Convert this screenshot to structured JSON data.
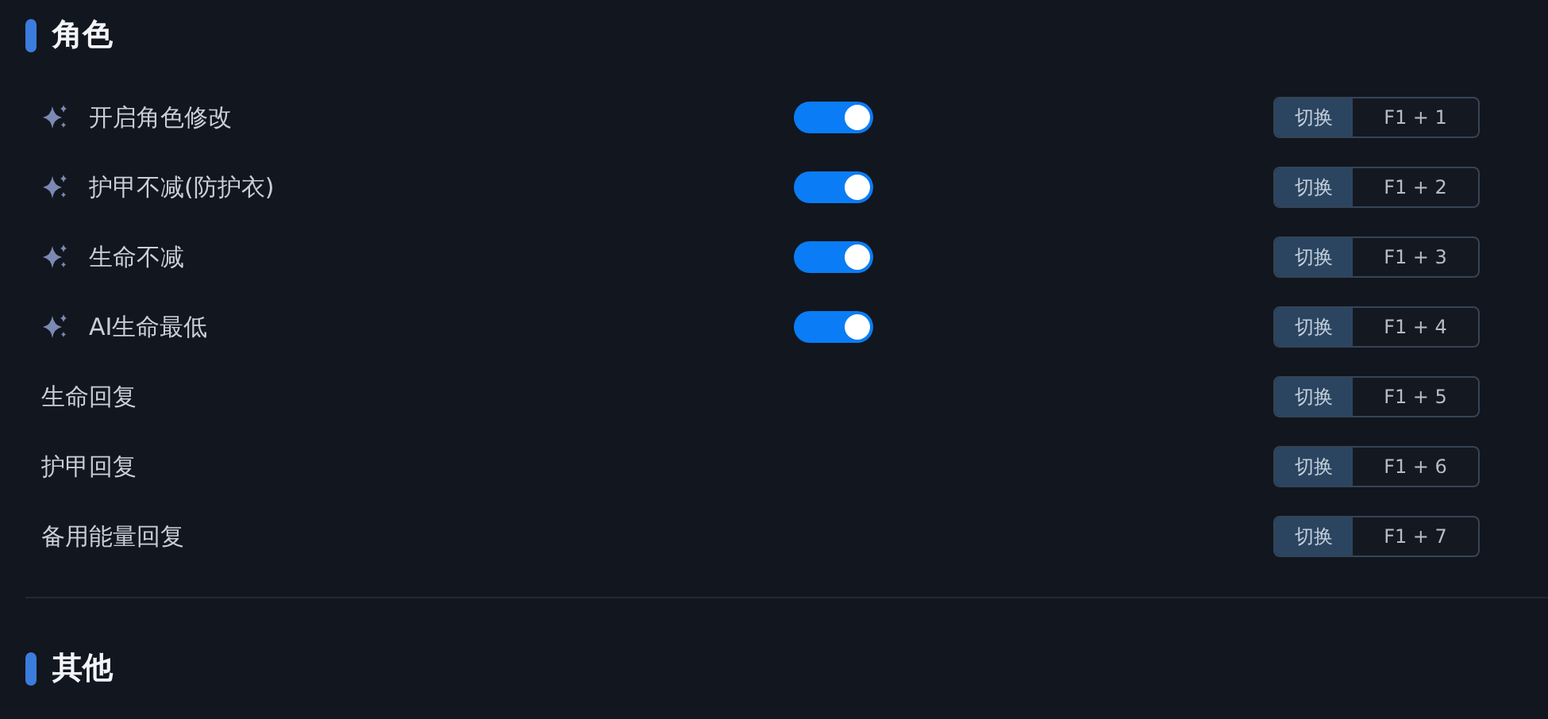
{
  "sections": [
    {
      "title": "角色",
      "rows": [
        {
          "kind": "toggle",
          "label": "开启角色修改",
          "on": true,
          "action": "切换",
          "hotkey": "F1 + 1"
        },
        {
          "kind": "toggle",
          "label": "护甲不减(防护衣)",
          "on": true,
          "action": "切换",
          "hotkey": "F1 + 2"
        },
        {
          "kind": "toggle",
          "label": "生命不减",
          "on": true,
          "action": "切换",
          "hotkey": "F1 + 3"
        },
        {
          "kind": "toggle",
          "label": "AI生命最低",
          "on": true,
          "action": "切换",
          "hotkey": "F1 + 4"
        },
        {
          "kind": "plain",
          "label": "生命回复",
          "action": "切换",
          "hotkey": "F1 + 5"
        },
        {
          "kind": "plain",
          "label": "护甲回复",
          "action": "切换",
          "hotkey": "F1 + 6"
        },
        {
          "kind": "plain",
          "label": "备用能量回复",
          "action": "切换",
          "hotkey": "F1 + 7"
        }
      ]
    },
    {
      "title": "其他"
    }
  ]
}
